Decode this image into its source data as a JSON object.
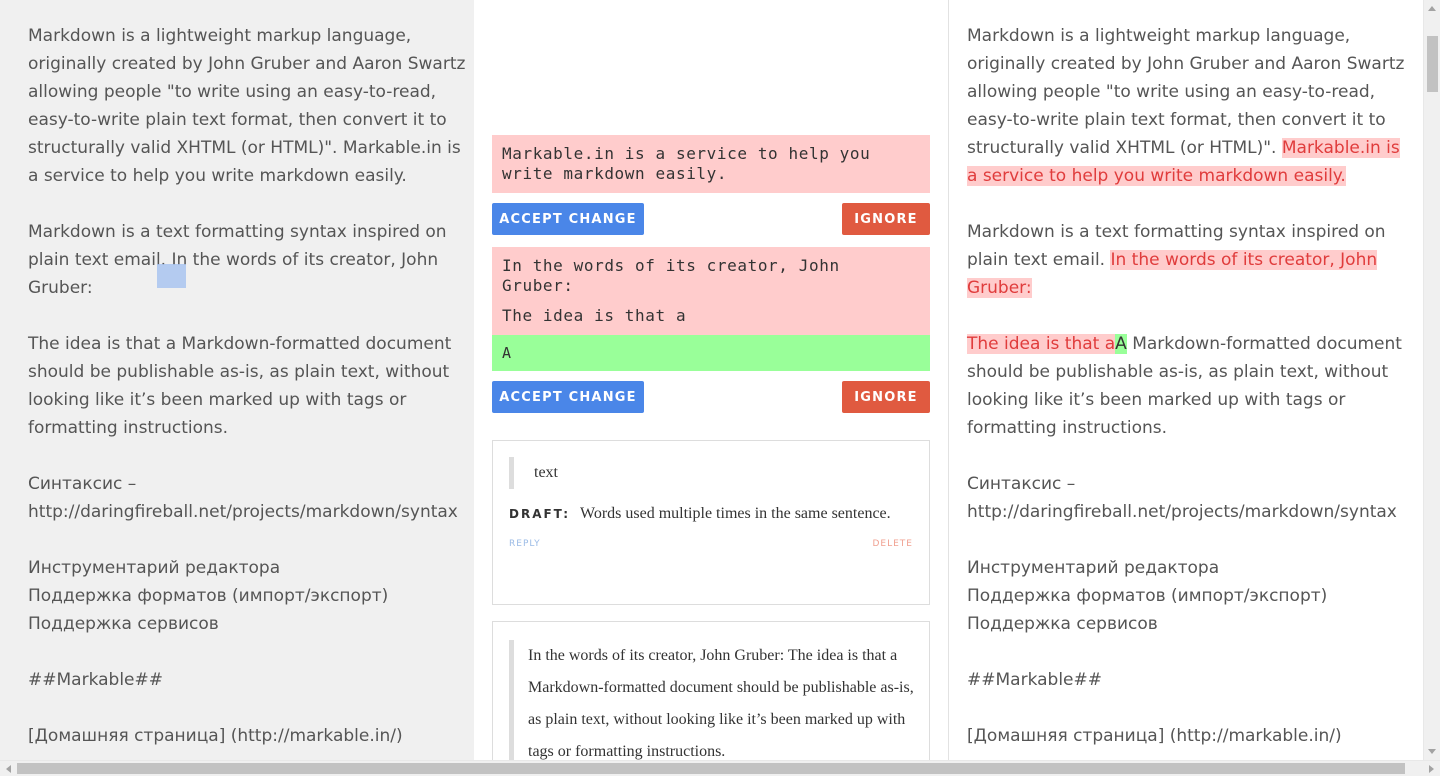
{
  "left_panel": {
    "paragraphs": [
      "Markdown is a lightweight markup language, originally created by John Gruber and Aaron Swartz allowing people \"to write using an easy-to-read, easy-to-write plain text format, then convert it to structurally valid XHTML (or HTML)\". Markable.in is a service to help you write markdown easily.",
      "Markdown is a text formatting syntax inspired on plain text email. In the words of its creator, John Gruber:",
      "The idea is that a Markdown-formatted document should be publishable as-is, as plain text, without looking like it’s been marked up with tags or formatting instructions.",
      "Синтаксис – http://daringfireball.net/projects/markdown/syntax",
      "Инструментарий редактора\nПоддержка форматов (импорт/экспорт)\nПоддержка сервисов",
      "##Markable##",
      "[Домашняя страница] (http://markable.in/)"
    ]
  },
  "changes": [
    {
      "deleted": [
        "Markable.in is a service to help you write markdown easily."
      ],
      "inserted": "",
      "accept_label": "ACCEPT CHANGE",
      "ignore_label": "IGNORE"
    },
    {
      "deleted": [
        "In the words of its creator, John Gruber:",
        "The idea is that a"
      ],
      "inserted": "A",
      "accept_label": "ACCEPT CHANGE",
      "ignore_label": "IGNORE"
    }
  ],
  "comments": [
    {
      "quote": "text",
      "draft_tag": "DRAFT:",
      "draft_text": "Words used multiple times in the same sentence.",
      "reply_label": "REPLY",
      "delete_label": "DELETE"
    },
    {
      "quote": "In the words of its creator, John Gruber: The idea is that a Markdown-formatted document should be publishable as-is, as plain text, without looking like it’s been marked up with tags or formatting instructions."
    }
  ],
  "right_panel": {
    "p1_plain": "Markdown is a lightweight markup language, originally created by John Gruber and Aaron Swartz allowing people \"to write using an easy-to-read, easy-to-write plain text format, then convert it to structurally valid XHTML (or HTML)\". ",
    "p1_deleted": "Markable.in is a service to help you write markdown easily.",
    "p2_plain": "Markdown is a text formatting syntax inspired on plain text email. ",
    "p2_deleted": "In the words of its creator, John Gruber:",
    "p3_deleted": "The idea is that a",
    "p3_inserted": "A",
    "p3_plain": " Markdown-formatted document should be publishable as-is, as plain text, without looking like it’s been marked up with tags or formatting instructions.",
    "paragraphs": [
      "Синтаксис – http://daringfireball.net/projects/markdown/syntax",
      "Инструментарий редактора\nПоддержка форматов (импорт/экспорт)\nПоддержка сервисов",
      "##Markable##",
      "[Домашняя страница] (http://markable.in/)"
    ]
  },
  "colors": {
    "left_bg": "#f0f0f0",
    "deleted_bg": "#ffcccc",
    "deleted_text": "#e03c3c",
    "inserted_bg": "#99ff99",
    "accept_button": "#4a86e8",
    "ignore_button": "#e05a40"
  }
}
